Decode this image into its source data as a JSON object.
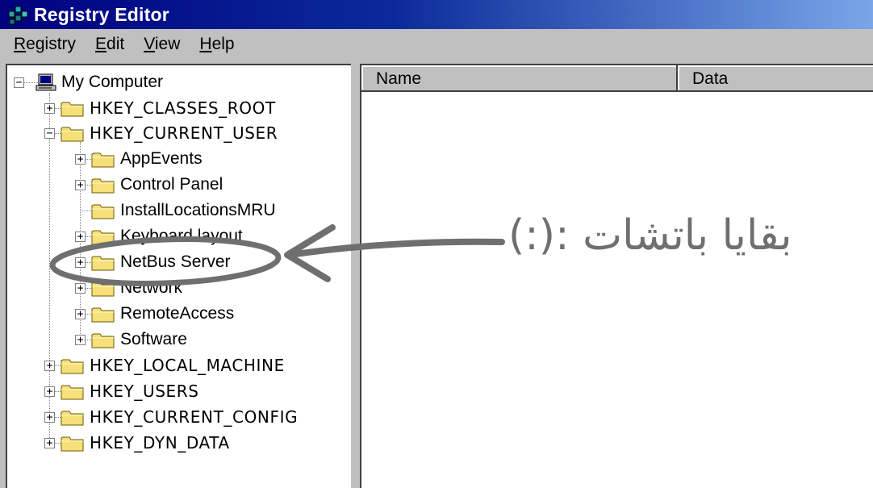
{
  "window": {
    "title": "Registry Editor"
  },
  "menu": [
    {
      "underline": "R",
      "rest": "egistry"
    },
    {
      "underline": "E",
      "rest": "dit"
    },
    {
      "underline": "V",
      "rest": "iew"
    },
    {
      "underline": "H",
      "rest": "elp"
    }
  ],
  "tree": {
    "root": "My Computer",
    "hkcr": "HKEY_CLASSES_ROOT",
    "hkcu": "HKEY_CURRENT_USER",
    "hkcu_children": [
      "AppEvents",
      "Control Panel",
      "InstallLocationsMRU",
      "Keyboard layout",
      "NetBus Server",
      "Network",
      "RemoteAccess",
      "Software"
    ],
    "hklm": "HKEY_LOCAL_MACHINE",
    "hku": "HKEY_USERS",
    "hkcc": "HKEY_CURRENT_CONFIG",
    "hkdd": "HKEY_DYN_DATA"
  },
  "list": {
    "col_name": "Name",
    "col_data": "Data"
  },
  "annotation": {
    "text": "بقايا باتشات :(:)",
    "color": "#6f6f6f"
  }
}
